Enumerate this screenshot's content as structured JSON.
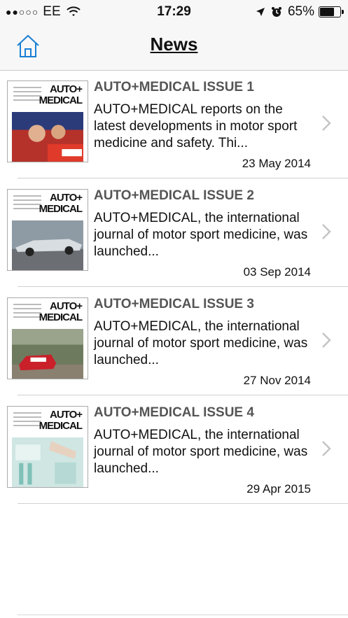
{
  "status_bar": {
    "signal_dots": "●●○○○",
    "carrier": "EE",
    "time": "17:29",
    "battery": "65%",
    "battery_level": 0.65
  },
  "nav": {
    "title": "News"
  },
  "items": [
    {
      "title": "AUTO+MEDICAL ISSUE 1",
      "description": "AUTO+MEDICAL reports on the latest developments in motor sport medicine and safety. Thi...",
      "date": "23 May 2014",
      "cover_title": "AUTO+ MEDICAL"
    },
    {
      "title": "AUTO+MEDICAL ISSUE 2",
      "description": "AUTO+MEDICAL, the international journal of motor sport medicine, was launched...",
      "date": "03 Sep 2014",
      "cover_title": "AUTO+ MEDICAL"
    },
    {
      "title": "AUTO+MEDICAL ISSUE 3",
      "description": "AUTO+MEDICAL, the international journal of motor sport medicine, was launched...",
      "date": "27 Nov 2014",
      "cover_title": "AUTO+ MEDICAL"
    },
    {
      "title": "AUTO+MEDICAL ISSUE 4",
      "description": "AUTO+MEDICAL, the international journal of motor sport medicine, was launched...",
      "date": "29 Apr 2015",
      "cover_title": "AUTO+ MEDICAL"
    }
  ],
  "colors": {
    "accent": "#1a7fd4",
    "title_gray": "#555555"
  }
}
